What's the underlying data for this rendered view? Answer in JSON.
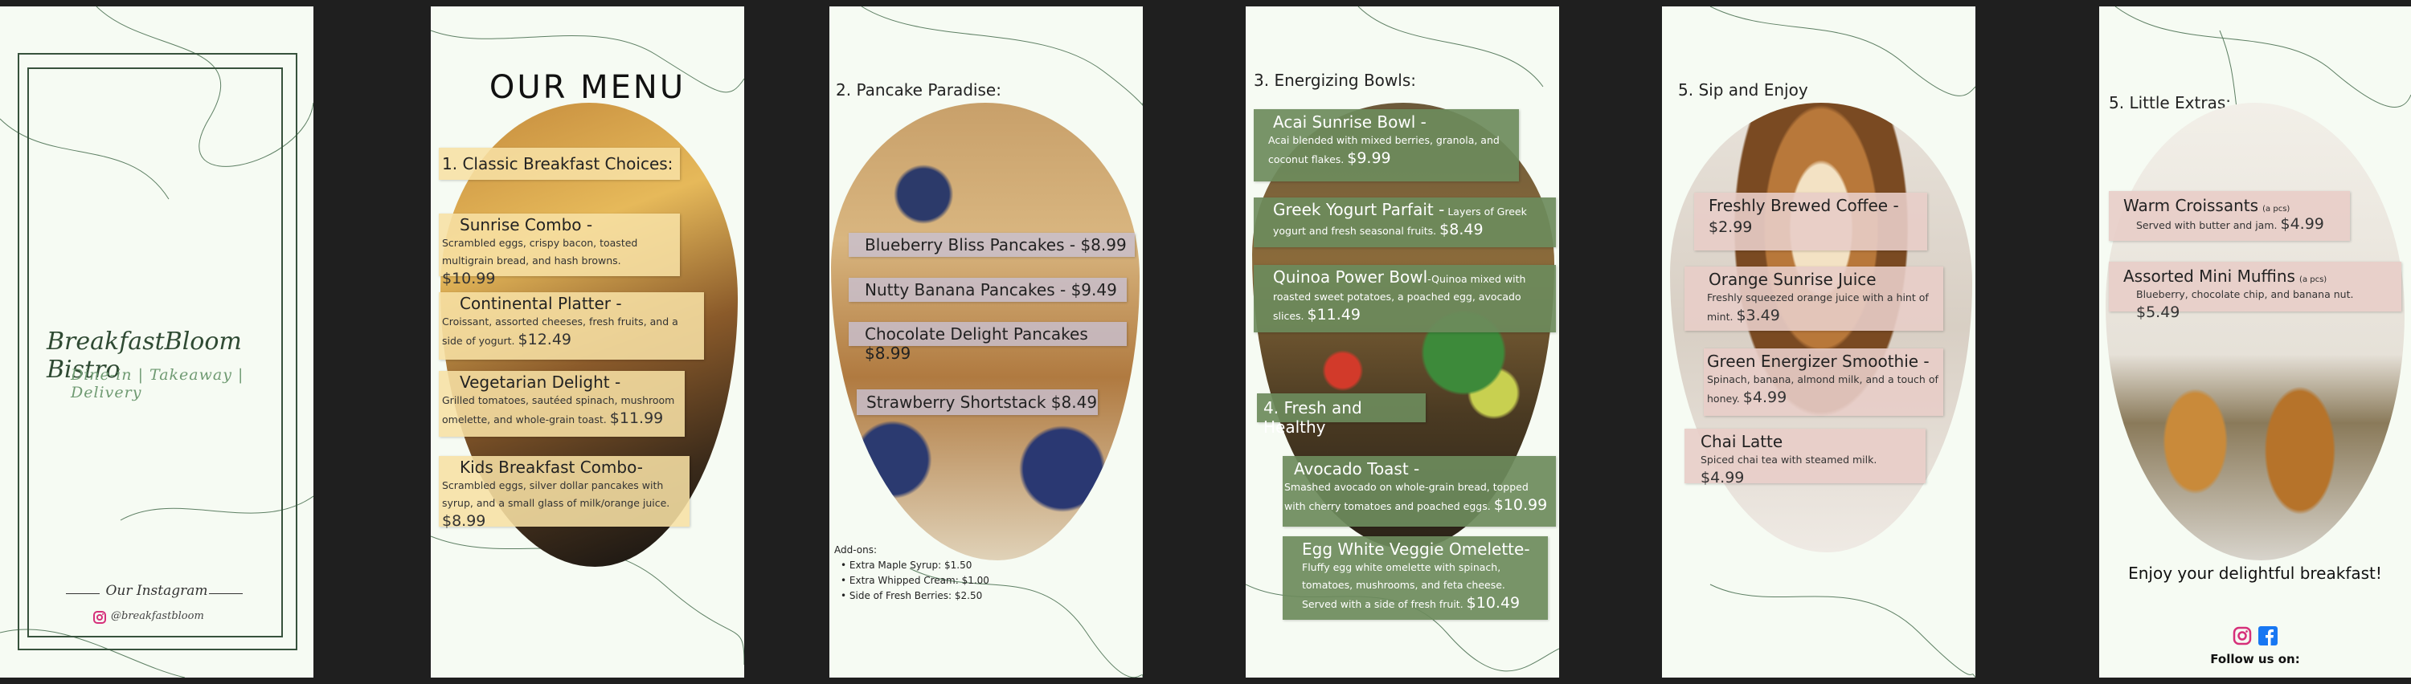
{
  "page1": {
    "brand": "BreakfastBloom Bistro",
    "tagline": "Dine-in | Takeaway | Delivery",
    "instagram_title": "Our Instagram",
    "instagram_handle": "@breakfastbloom",
    "instagram_icon": "instagram-icon"
  },
  "page2": {
    "title": "OUR MENU",
    "section": "1. Classic Breakfast Choices:",
    "items": [
      {
        "name": "Sunrise Combo -",
        "desc": "Scrambled eggs, crispy bacon, toasted multigrain bread, and hash browns.",
        "price": "$10.99"
      },
      {
        "name": "Continental Platter -",
        "desc": "Croissant, assorted cheeses, fresh fruits, and a side of yogurt.",
        "price": "$12.49"
      },
      {
        "name": "Vegetarian Delight -",
        "desc": "Grilled tomatoes, sautéed spinach, mushroom omelette, and whole-grain toast.",
        "price": "$11.99"
      },
      {
        "name": "Kids Breakfast Combo-",
        "desc": "Scrambled eggs, silver dollar pancakes with syrup, and a small glass of milk/orange juice.",
        "price": "$8.99"
      }
    ]
  },
  "page3": {
    "section": "2. Pancake Paradise:",
    "items": [
      {
        "label": "Blueberry Bliss Pancakes - $8.99"
      },
      {
        "label": "Nutty Banana Pancakes - $9.49"
      },
      {
        "label": "Chocolate Delight Pancakes $8.99"
      },
      {
        "label": "Strawberry Shortstack $8.49"
      }
    ],
    "addons_title": "Add-ons:",
    "addons": [
      "Extra Maple Syrup: $1.50",
      "Extra Whipped Cream: $1.00",
      "Side of Fresh Berries: $2.50"
    ]
  },
  "page4": {
    "section": "3. Energizing Bowls:",
    "items": [
      {
        "name": "Acai Sunrise Bowl -",
        "desc": "Acai blended with mixed berries, granola, and coconut flakes.",
        "price": "$9.99"
      },
      {
        "name": "Greek Yogurt Parfait -",
        "desc": "Layers of Greek yogurt and fresh seasonal fruits.",
        "price": "$8.49"
      },
      {
        "name": "Quinoa Power Bowl",
        "desc": "-Quinoa mixed with roasted sweet potatoes, a poached egg, avocado slices.",
        "price": "$11.49"
      }
    ],
    "section2": "4. Fresh and Healthy",
    "items2": [
      {
        "name": "Avocado Toast -",
        "desc": "Smashed avocado on whole-grain bread, topped with cherry tomatoes and poached eggs.",
        "price": "$10.99"
      },
      {
        "name": "Egg White Veggie Omelette-",
        "desc": "Fluffy egg white omelette with spinach, tomatoes, mushrooms, and feta cheese. Served with a side of fresh fruit.",
        "price": "$10.49"
      }
    ]
  },
  "page5": {
    "section": "5. Sip and Enjoy",
    "items": [
      {
        "name": "Freshly Brewed Coffee -",
        "desc": "",
        "price": "$2.99"
      },
      {
        "name": "Orange Sunrise Juice",
        "desc": "Freshly squeezed orange juice with a hint of mint.",
        "price": "$3.49"
      },
      {
        "name": "Green Energizer Smoothie -",
        "desc": "Spinach, banana, almond milk, and a touch of honey.",
        "price": "$4.99"
      },
      {
        "name": "Chai Latte",
        "desc": "Spiced chai tea with steamed milk.",
        "price": "$4.99"
      }
    ]
  },
  "page6": {
    "section": "5. Little Extras:",
    "items": [
      {
        "name": "Warm Croissants",
        "unit": "(a pcs)",
        "desc": "Served with butter and jam.",
        "price": "$4.99"
      },
      {
        "name": "Assorted Mini Muffins",
        "unit": "(a pcs)",
        "desc": "Blueberry, chocolate chip, and banana nut.",
        "price": "$5.49"
      }
    ],
    "enjoy": "Enjoy your delightful breakfast!",
    "follow": "Follow us on:",
    "icons": [
      "instagram-icon",
      "facebook-icon"
    ]
  },
  "colors": {
    "background": "#1f1f1f",
    "page": "#f6fbf3",
    "accent_green": "#37523c",
    "green_box": "#6c8b5c",
    "yellow_box": "#f7e0a4"
  }
}
